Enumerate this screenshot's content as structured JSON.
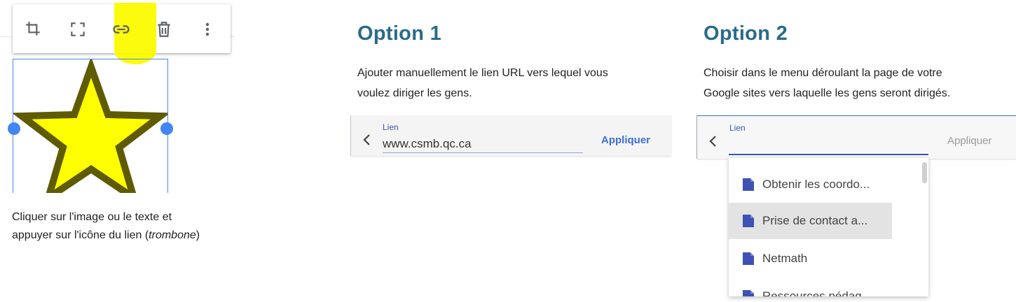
{
  "toolbar": {
    "buttons": [
      {
        "name": "crop-icon"
      },
      {
        "name": "fullscreen-icon"
      },
      {
        "name": "link-icon",
        "highlighted": true
      },
      {
        "name": "trash-icon"
      },
      {
        "name": "more-vertical-icon"
      }
    ],
    "highlight_color": "#fcfa00"
  },
  "image": {
    "icon": "star-icon",
    "fill": "#ffff00",
    "stroke": "#5f5b00"
  },
  "caption": {
    "line1": "Cliquer sur l'image ou le texte  et",
    "line2_prefix": "appuyer sur l'icône du lien (",
    "line2_em": "trombone",
    "line2_suffix": ")"
  },
  "option1": {
    "title": "Option 1",
    "desc_line1": "Ajouter manuellement le lien URL vers lequel vous",
    "desc_line2": "voulez diriger les gens.",
    "link_bar": {
      "label": "Lien",
      "value": "www.csmb.qc.ca",
      "apply": "Appliquer"
    }
  },
  "option2": {
    "title": "Option 2",
    "desc_line1": "Choisir dans le menu déroulant la page de votre",
    "desc_line2": "Google sites vers laquelle les gens seront dirigés.",
    "link_bar": {
      "label": "Lien",
      "value": "",
      "apply": "Appliquer"
    },
    "dropdown": [
      {
        "label": "Obtenir les coordo...",
        "selected": false
      },
      {
        "label": "Prise de contact a...",
        "selected": true
      },
      {
        "label": "Netmath",
        "selected": false
      },
      {
        "label": "Ressources pédag...",
        "selected": false
      }
    ]
  },
  "colors": {
    "title": "#2a6a8a",
    "accent": "#3c57b0",
    "selection": "#4285f4"
  }
}
